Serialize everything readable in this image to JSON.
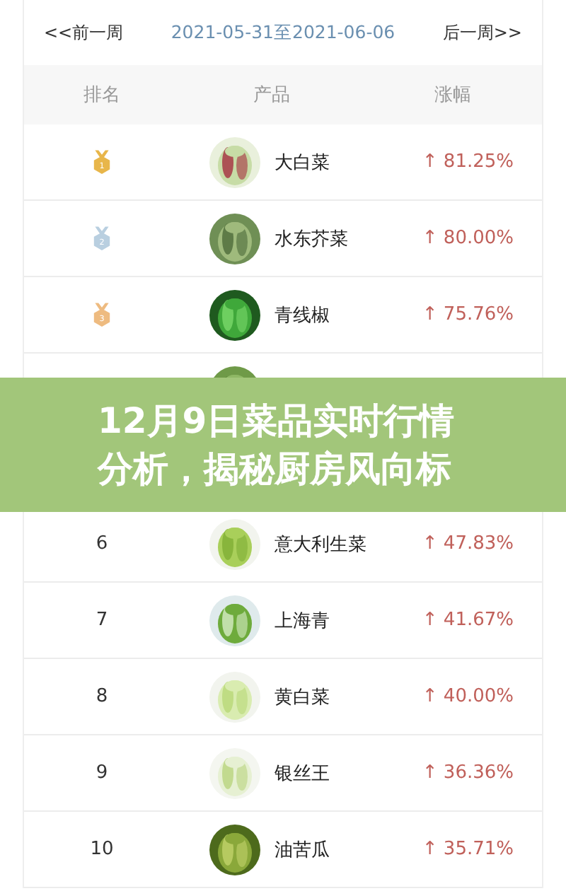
{
  "week_nav": {
    "prev": "<<前一周",
    "range": "2021-05-31至2021-06-06",
    "next": "后一周>>"
  },
  "table": {
    "columns": [
      "排名",
      "产品",
      "涨幅"
    ],
    "rows": [
      {
        "kind": "medal",
        "rank": "1",
        "color": "#e8b64a",
        "name": "大白菜",
        "change": "↑ 81.25%"
      },
      {
        "kind": "medal",
        "rank": "2",
        "color": "#b9cfe0",
        "name": "水东芥菜",
        "change": "↑ 80.00%"
      },
      {
        "kind": "medal",
        "rank": "3",
        "color": "#eebb80",
        "name": "青线椒",
        "change": "↑ 75.76%"
      },
      {
        "kind": "number"
      },
      {
        "kind": "blank"
      },
      {
        "kind": "number",
        "rank": "6",
        "name": "意大利生菜",
        "change": "↑ 47.83%"
      },
      {
        "kind": "number",
        "rank": "7",
        "name": "上海青",
        "change": "↑ 41.67%"
      },
      {
        "kind": "number",
        "rank": "8",
        "name": "黄白菜",
        "change": "↑ 40.00%"
      },
      {
        "kind": "number",
        "rank": "9",
        "name": "银丝王",
        "change": "↑ 36.36%"
      },
      {
        "kind": "number",
        "rank": "10",
        "name": "油苦瓜",
        "change": "↑ 35.71%"
      }
    ]
  },
  "banner": {
    "title": "12月9日菜品实时行情分析，揭秘厨房风向标"
  }
}
